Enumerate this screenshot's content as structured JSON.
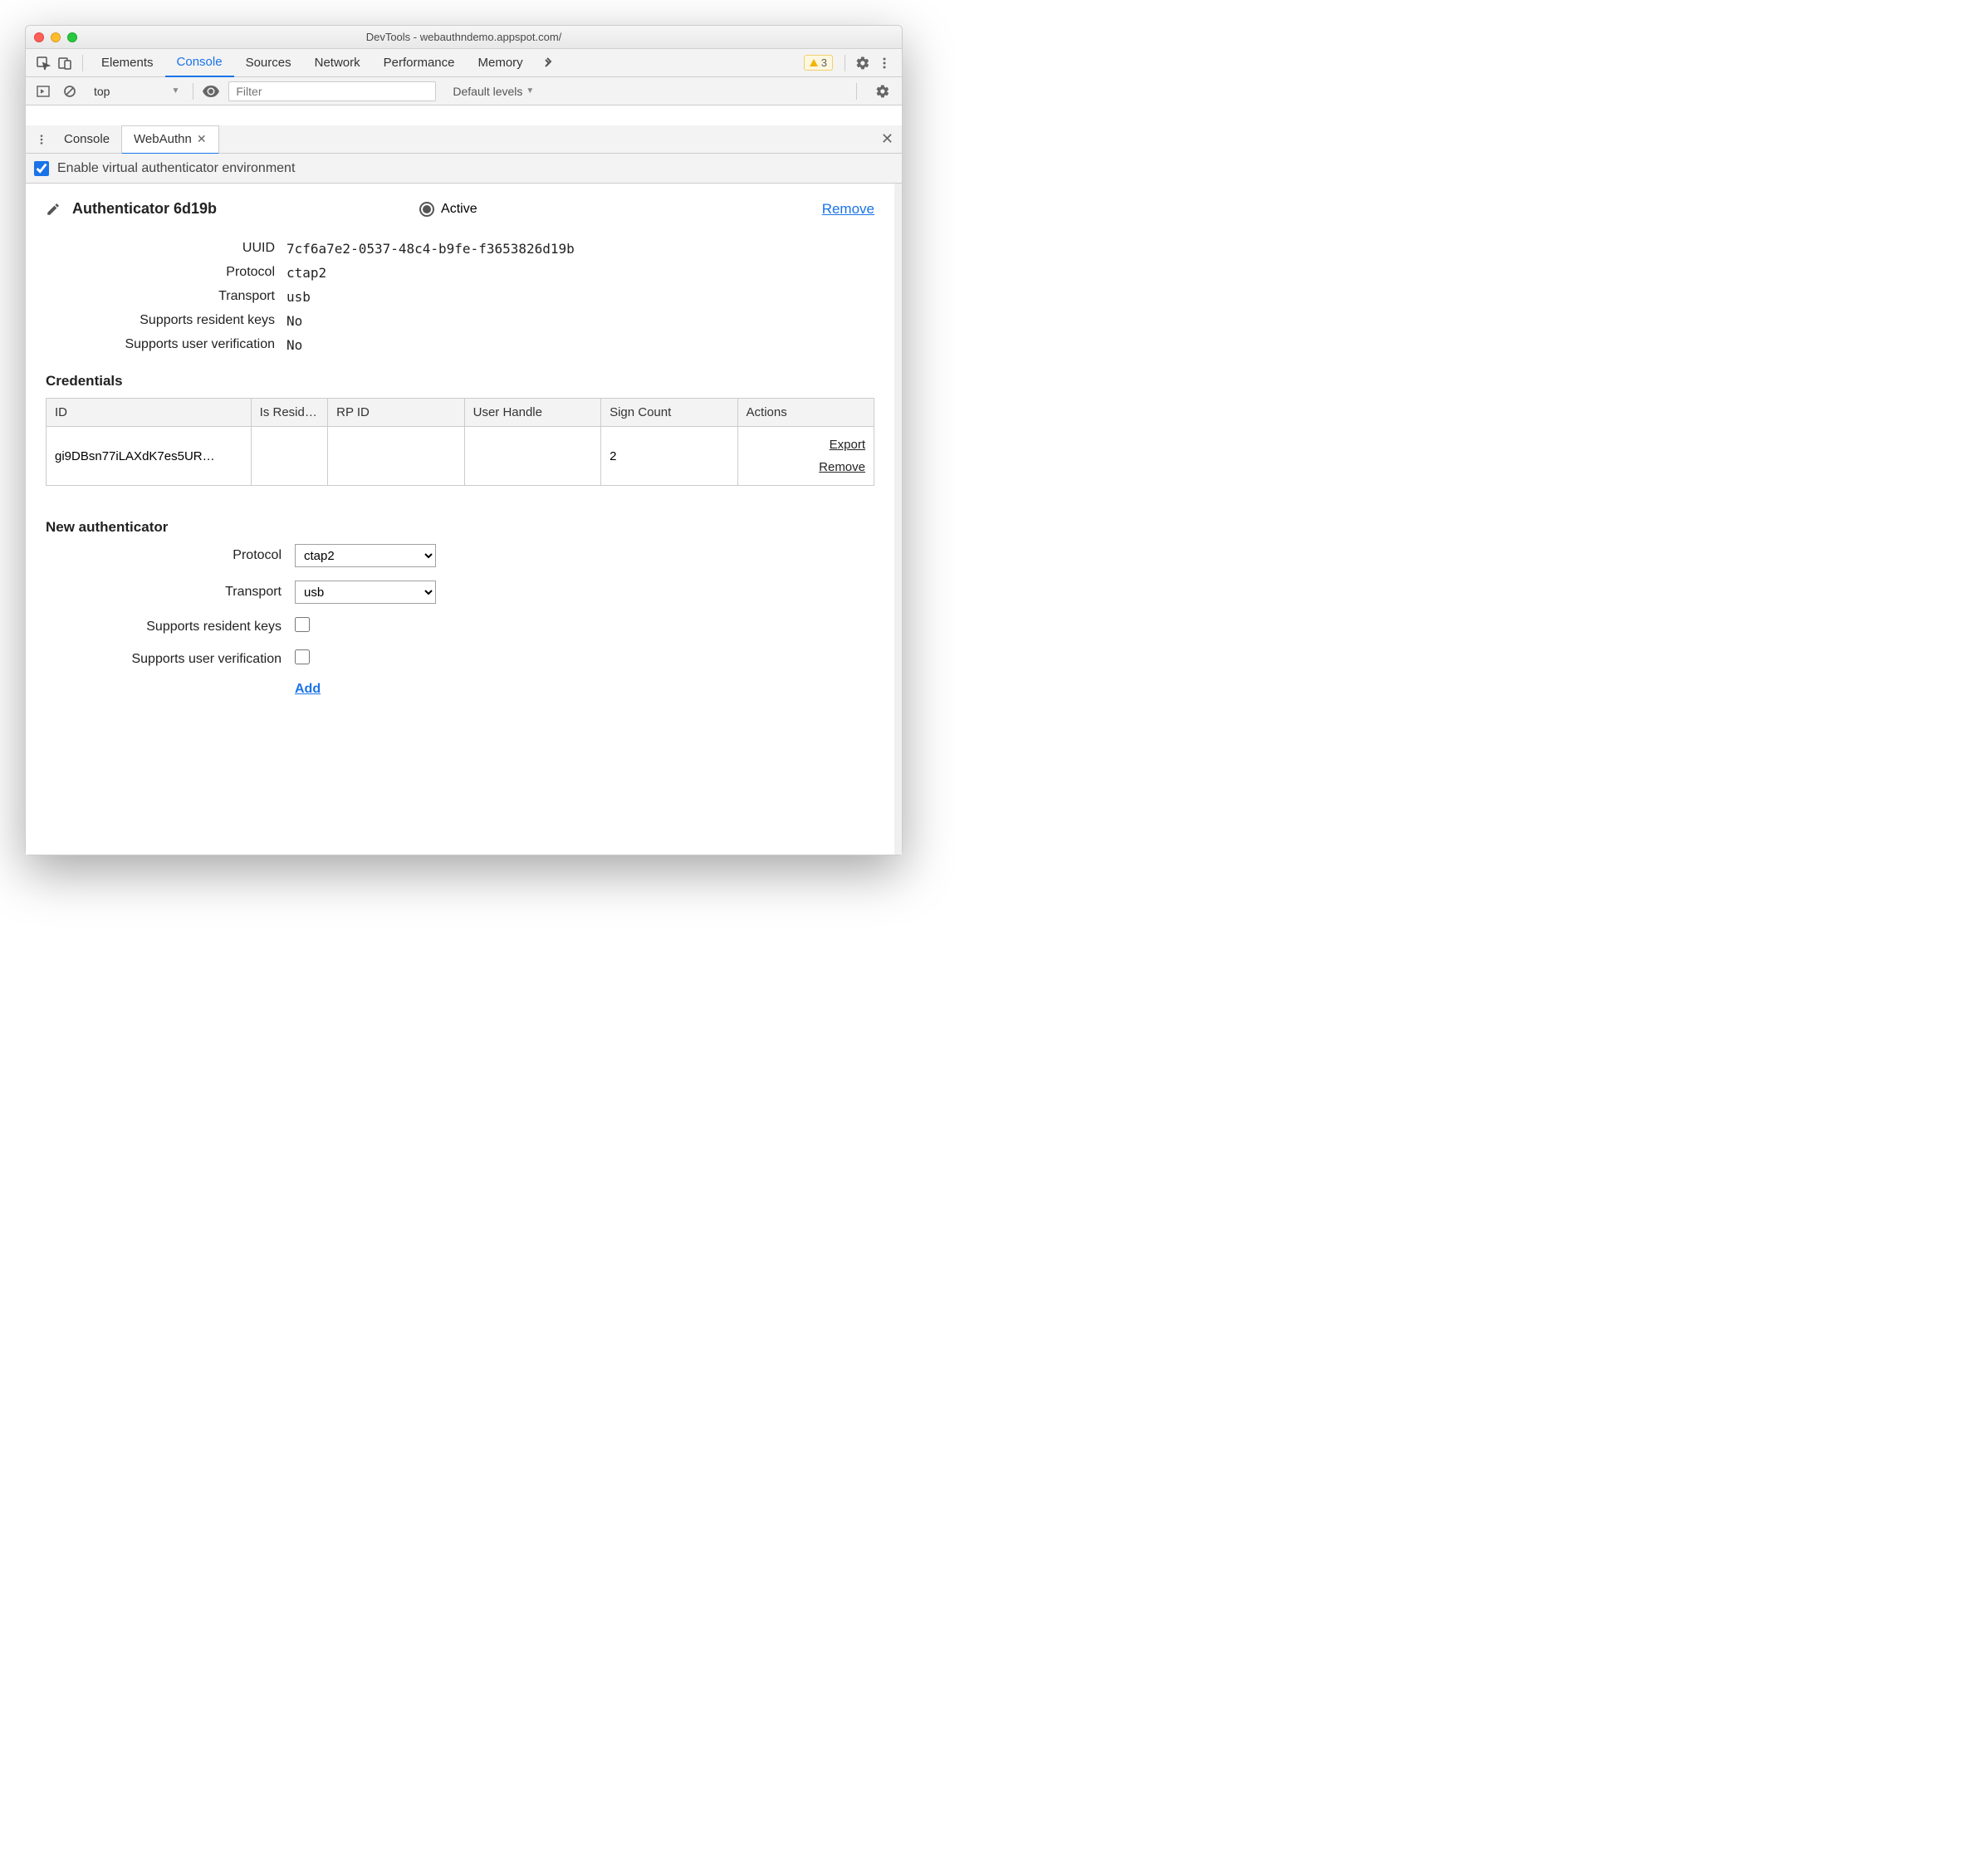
{
  "window_title": "DevTools - webauthndemo.appspot.com/",
  "main_tabs": {
    "items": [
      "Elements",
      "Console",
      "Sources",
      "Network",
      "Performance",
      "Memory"
    ],
    "active_index": 1
  },
  "warnings_count": "3",
  "console_toolbar": {
    "context": "top",
    "filter_placeholder": "Filter",
    "levels_label": "Default levels"
  },
  "drawer": {
    "tabs": [
      "Console",
      "WebAuthn"
    ],
    "active_index": 1
  },
  "enable_checkbox": {
    "label": "Enable virtual authenticator environment",
    "checked": true
  },
  "authenticator": {
    "title": "Authenticator 6d19b",
    "active_label": "Active",
    "remove_label": "Remove",
    "fields": {
      "uuid": {
        "label": "UUID",
        "value": "7cf6a7e2-0537-48c4-b9fe-f3653826d19b"
      },
      "protocol": {
        "label": "Protocol",
        "value": "ctap2"
      },
      "transport": {
        "label": "Transport",
        "value": "usb"
      },
      "resident": {
        "label": "Supports resident keys",
        "value": "No"
      },
      "userverif": {
        "label": "Supports user verification",
        "value": "No"
      }
    }
  },
  "credentials": {
    "title": "Credentials",
    "headers": {
      "id": "ID",
      "resident": "Is Resid…",
      "rpid": "RP ID",
      "userhandle": "User Handle",
      "signcount": "Sign Count",
      "actions": "Actions"
    },
    "row": {
      "id": "gi9DBsn77iLAXdK7es5UR…",
      "resident": "",
      "rpid": "",
      "userhandle": "",
      "signcount": "2",
      "export": "Export",
      "remove": "Remove"
    }
  },
  "new_auth": {
    "title": "New authenticator",
    "protocol": {
      "label": "Protocol",
      "value": "ctap2"
    },
    "transport": {
      "label": "Transport",
      "value": "usb"
    },
    "resident": {
      "label": "Supports resident keys"
    },
    "userverif": {
      "label": "Supports user verification"
    },
    "add_label": "Add"
  }
}
